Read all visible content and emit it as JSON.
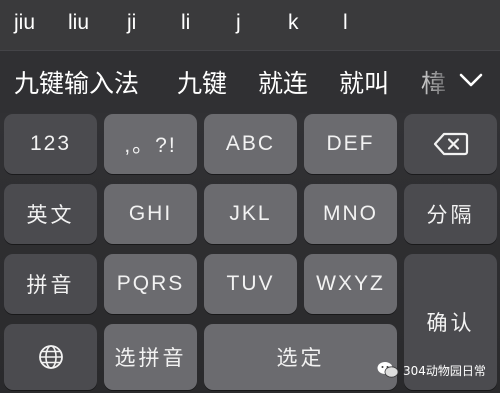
{
  "pinyin_options": [
    "jiu",
    "liu",
    "ji",
    "li",
    "j",
    "k",
    "l"
  ],
  "candidates": [
    "九键输入法",
    "九键",
    "就连",
    "就叫",
    "椲"
  ],
  "expand_icon": "chevron-down-icon",
  "keys": {
    "num": "123",
    "punct": ",。?!",
    "abc": "ABC",
    "def": "DEF",
    "delete_icon": "backspace-icon",
    "english": "英文",
    "ghi": "GHI",
    "jkl": "JKL",
    "mno": "MNO",
    "separate": "分隔",
    "pinyin": "拼音",
    "pqrs": "PQRS",
    "tuv": "TUV",
    "wxyz": "WXYZ",
    "confirm": "确认",
    "globe_icon": "globe-icon",
    "select_pinyin": "选拼音",
    "select": "选定"
  },
  "watermark": {
    "text": "304动物园日常",
    "icon": "wechat-icon"
  },
  "colors": {
    "dark_key": "#4b4b4f",
    "light_key": "#6b6b6f",
    "text": "#ffffff"
  }
}
